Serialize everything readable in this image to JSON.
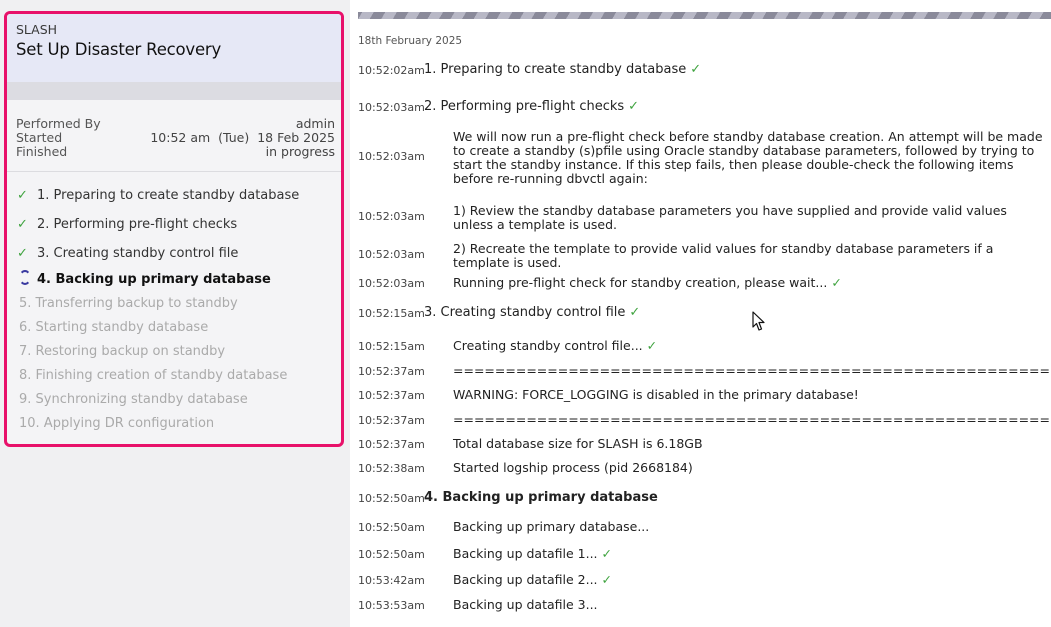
{
  "task": {
    "db_name": "SLASH",
    "title": "Set Up Disaster Recovery",
    "performed_by_label": "Performed By",
    "performed_by": "admin",
    "started_label": "Started",
    "started_time": "10:52 am",
    "started_day": "(Tue)",
    "started_date": "18 Feb 2025",
    "finished_label": "Finished",
    "finished": "in progress"
  },
  "steps": [
    {
      "label": "1. Preparing to create standby database",
      "status": "done"
    },
    {
      "label": "2. Performing pre-flight checks",
      "status": "done"
    },
    {
      "label": "3. Creating standby control file",
      "status": "done"
    },
    {
      "label": "4. Backing up primary database",
      "status": "current"
    },
    {
      "label": "5. Transferring backup to standby",
      "status": "pending"
    },
    {
      "label": "6. Starting standby database",
      "status": "pending"
    },
    {
      "label": "7. Restoring backup on standby",
      "status": "pending"
    },
    {
      "label": "8. Finishing creation of standby database",
      "status": "pending"
    },
    {
      "label": "9. Synchronizing standby database",
      "status": "pending"
    },
    {
      "label": "10. Applying DR configuration",
      "status": "pending"
    }
  ],
  "log": {
    "date_header": "18th February 2025",
    "entries": [
      {
        "time": "10:52:02am",
        "text": "1. Preparing to create standby database",
        "kind": "step",
        "ok": true
      },
      {
        "time": "10:52:03am",
        "text": "2. Performing pre-flight checks",
        "kind": "step",
        "ok": true
      },
      {
        "time": "10:52:03am",
        "text": "We will now run a pre-flight check before standby database creation. An attempt will be made to create a standby (s)pfile using Oracle standby database parameters, followed by trying to start the standby instance. If this step fails, then please double-check the following items before re-running dbvctl again:",
        "kind": "sub",
        "ok": false
      },
      {
        "time": "10:52:03am",
        "text": "1) Review the standby database parameters you have supplied and provide valid values unless a template is used.",
        "kind": "sub",
        "ok": false
      },
      {
        "time": "10:52:03am",
        "text": "2) Recreate the template to provide valid values for standby database parameters if a template is used.",
        "kind": "sub",
        "ok": false
      },
      {
        "time": "10:52:03am",
        "text": "Running pre-flight check for standby creation, please wait...",
        "kind": "sub",
        "ok": true
      },
      {
        "time": "10:52:15am",
        "text": "3. Creating standby control file",
        "kind": "step",
        "ok": true
      },
      {
        "time": "10:52:15am",
        "text": "Creating standby control file...",
        "kind": "sub",
        "ok": true
      },
      {
        "time": "10:52:37am",
        "text": "=========================================================",
        "kind": "sub",
        "ok": false
      },
      {
        "time": "10:52:37am",
        "text": "WARNING: FORCE_LOGGING is disabled in the primary database!",
        "kind": "sub",
        "ok": false
      },
      {
        "time": "10:52:37am",
        "text": "=========================================================",
        "kind": "sub",
        "ok": false
      },
      {
        "time": "10:52:37am",
        "text": "Total database size for SLASH is 6.18GB",
        "kind": "sub",
        "ok": false
      },
      {
        "time": "10:52:38am",
        "text": "Started logship process (pid 2668184)",
        "kind": "sub",
        "ok": false
      },
      {
        "time": "10:52:50am",
        "text": "4. Backing up primary database",
        "kind": "step-bold",
        "ok": false
      },
      {
        "time": "10:52:50am",
        "text": "Backing up primary database...",
        "kind": "sub",
        "ok": false
      },
      {
        "time": "10:52:50am",
        "text": "Backing up datafile 1...",
        "kind": "sub",
        "ok": true
      },
      {
        "time": "10:53:42am",
        "text": "Backing up datafile 2...",
        "kind": "sub",
        "ok": true
      },
      {
        "time": "10:53:53am",
        "text": "Backing up datafile 3...",
        "kind": "sub",
        "ok": false
      }
    ]
  },
  "icons": {
    "check": "check-icon",
    "spinner": "spinner-icon",
    "cursor": "mouse-cursor-icon"
  },
  "colors": {
    "accent_border": "#e8116a",
    "check": "#3fa33f",
    "header_bg": "#e6e8f6"
  }
}
